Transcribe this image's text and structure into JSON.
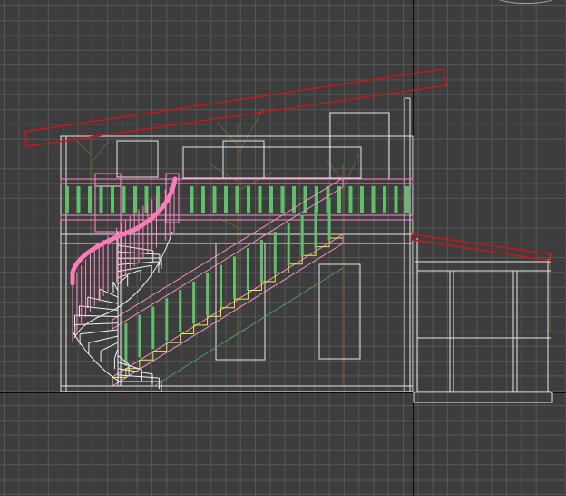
{
  "viewport": {
    "background": "#3d3d3d",
    "grid_color": "#565656",
    "axis_color": "#0a0a0a"
  },
  "colors": {
    "roof": "#c8161a",
    "structure": "#e6e6e6",
    "railing": "#ff8cc6",
    "handrail": "#ff7ab8",
    "balusters": "#5fbf6a",
    "stair_steps": "#e6ef4a",
    "stringer": "#49a15a",
    "spiral_stair": "#f2f2f2",
    "tree": "#7c6a3a"
  },
  "icons": {
    "viewcube": "viewcube-icon"
  }
}
